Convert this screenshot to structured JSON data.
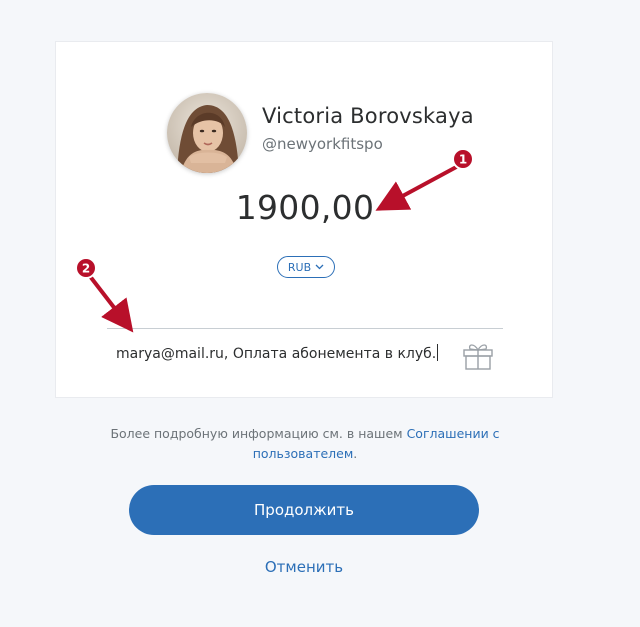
{
  "recipient": {
    "name": "Victoria Borovskaya",
    "handle": "@newyorkfitspo"
  },
  "amount": {
    "value": "1900,00",
    "currency": "RUB"
  },
  "note": {
    "value": "marya@mail.ru, Оплата абонемента в клуб."
  },
  "footer": {
    "text_before": "Более подробную информацию см. в нашем ",
    "link": "Соглашении с пользователем",
    "text_after": "."
  },
  "actions": {
    "continue_label": "Продолжить",
    "cancel_label": "Отменить"
  },
  "annotations": {
    "badge_1": "1",
    "badge_2": "2"
  },
  "colors": {
    "accent": "#2c6fb7",
    "annotation": "#b8102a",
    "background": "#f5f7fa"
  }
}
